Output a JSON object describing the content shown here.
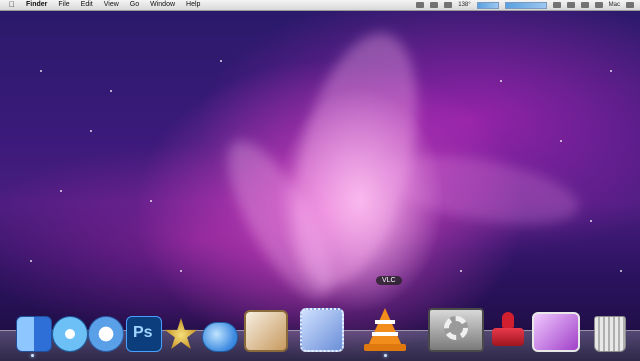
{
  "menubar": {
    "app": "Finder",
    "items": [
      "File",
      "Edit",
      "View",
      "Go",
      "Window",
      "Help"
    ],
    "status": {
      "temp": "138°",
      "user": "Mac"
    }
  },
  "dock": {
    "tooltip": "VLC",
    "items": [
      {
        "name": "finder",
        "color": "#3a7be0"
      },
      {
        "name": "safari",
        "color": "#4aa6e8"
      },
      {
        "name": "itunes",
        "color": "#4a8fe0"
      },
      {
        "name": "photoshop",
        "color": "#0a3c7a",
        "label": "Ps"
      },
      {
        "name": "imovie",
        "color": "#d8b040"
      },
      {
        "name": "ichat",
        "color": "#3a8ee8"
      },
      {
        "name": "preview",
        "color": "#c8a060"
      },
      {
        "name": "mail",
        "color": "#3a6ec0"
      },
      {
        "name": "vlc",
        "color": "#f08a1a"
      },
      {
        "name": "system-preferences",
        "color": "#8a8a8a"
      },
      {
        "name": "script-stamp",
        "color": "#d02030"
      },
      {
        "name": "photo-booth",
        "color": "#c860d8"
      },
      {
        "name": "trash",
        "color": "#c8c8c8"
      }
    ]
  }
}
